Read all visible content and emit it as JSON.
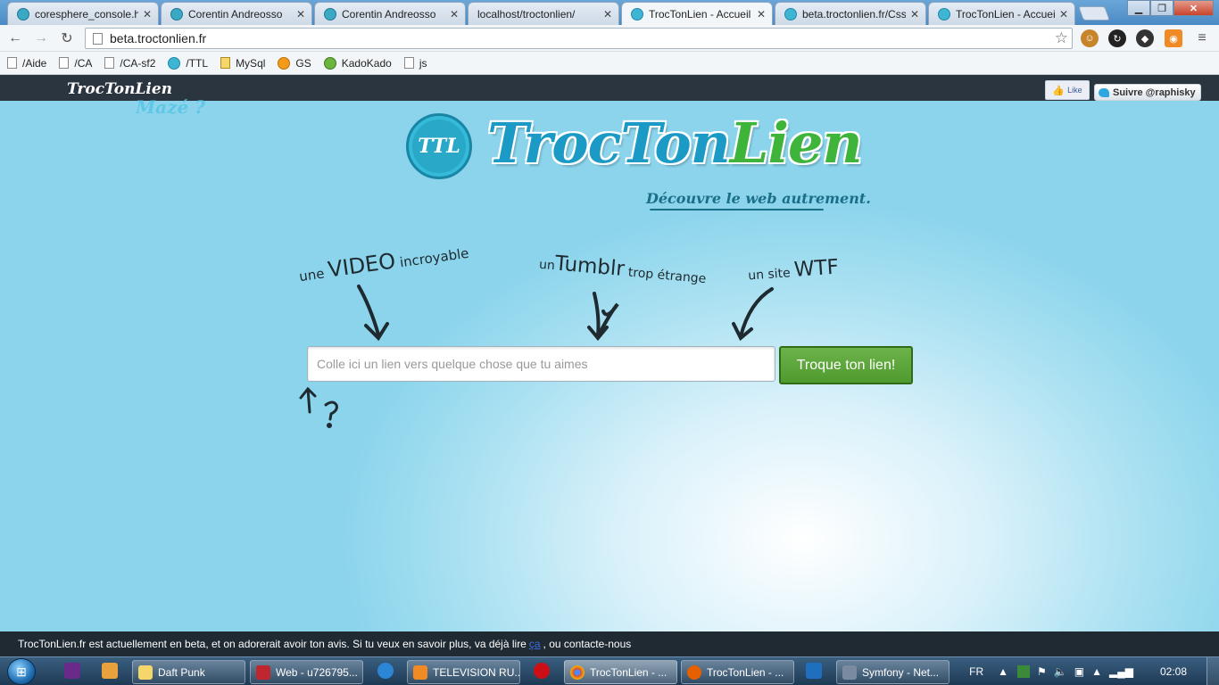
{
  "browser": {
    "tabs": [
      {
        "title": "coresphere_console.ht",
        "icon": "coresphere-icon"
      },
      {
        "title": "Corentin Andreosso",
        "icon": "coresphere-icon"
      },
      {
        "title": "Corentin Andreosso",
        "icon": "coresphere-icon"
      },
      {
        "title": "localhost/troctonlien/",
        "icon": "page-icon"
      },
      {
        "title": "TrocTonLien - Accueil",
        "icon": "ttl-icon"
      },
      {
        "title": "beta.troctonlien.fr/Css",
        "icon": "ttl-icon"
      },
      {
        "title": "TrocTonLien - Accueil",
        "icon": "ttl-icon"
      }
    ],
    "url": "beta.troctonlien.fr",
    "bookmarks": [
      {
        "label": "/Aide"
      },
      {
        "label": "/CA"
      },
      {
        "label": "/CA-sf2"
      },
      {
        "label": "/TTL"
      },
      {
        "label": "MySql"
      },
      {
        "label": "GS"
      },
      {
        "label": "KadoKado"
      },
      {
        "label": "js"
      }
    ]
  },
  "site": {
    "nav_logo": "TrocTonLien",
    "nav_logo_sub": "Mazé ?",
    "fb_like": "Like",
    "twitter_follow": "Suivre @raphisky",
    "logo_badge": "TTL",
    "logo_troc": "Troc",
    "logo_ton": "Ton",
    "logo_lien": "Lien",
    "tagline": "Découvre le web autrement.",
    "hints": {
      "h1_pre": "une ",
      "h1_big": "VIDEO",
      "h1_post": " incroyable",
      "h2_pre": "un",
      "h2_big": "Tumblr",
      "h2_post": " trop étrange",
      "h3_pre": "un site ",
      "h3_big": "WTF"
    },
    "input_placeholder": "Colle ici un lien vers quelque chose que tu aimes",
    "submit_label": "Troque ton lien!",
    "beta_text_1": "TrocTonLien.fr est actuellement en beta, et on adorerait avoir ton avis. Si tu veux en savoir plus, va déjà lire",
    "beta_link": "ça",
    "beta_text_2": ", ou contacte-nous"
  },
  "taskbar": {
    "tasks": [
      {
        "label": "Daft Punk"
      },
      {
        "label": "Web - u726795..."
      },
      {
        "label": "TELEVISION RU..."
      },
      {
        "label": "TrocTonLien - ..."
      },
      {
        "label": "TrocTonLien - ..."
      },
      {
        "label": "Symfony - Net..."
      }
    ],
    "lang": "FR",
    "clock": "02:08"
  },
  "colors": {
    "brand_blue": "#1a9ac4",
    "brand_green": "#3fb43a",
    "button_green": "#5ea83b"
  }
}
